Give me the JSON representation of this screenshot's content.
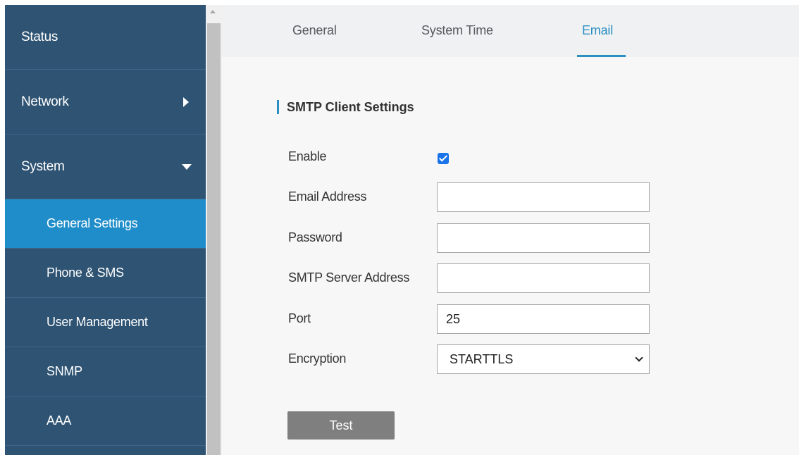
{
  "sidebar": {
    "items": [
      {
        "label": "Status"
      },
      {
        "label": "Network"
      },
      {
        "label": "System"
      }
    ],
    "sub_items": [
      {
        "label": "General Settings",
        "active": true
      },
      {
        "label": "Phone & SMS"
      },
      {
        "label": "User Management"
      },
      {
        "label": "SNMP"
      },
      {
        "label": "AAA"
      }
    ]
  },
  "tabs": [
    {
      "label": "General"
    },
    {
      "label": "System Time"
    },
    {
      "label": "Email",
      "active": true
    }
  ],
  "section": {
    "title": "SMTP Client Settings"
  },
  "form": {
    "enable": {
      "label": "Enable",
      "checked": true
    },
    "email_address": {
      "label": "Email Address",
      "value": ""
    },
    "password": {
      "label": "Password",
      "value": ""
    },
    "smtp_server": {
      "label": "SMTP Server Address",
      "value": ""
    },
    "port": {
      "label": "Port",
      "value": "25"
    },
    "encryption": {
      "label": "Encryption",
      "value": "STARTTLS"
    }
  },
  "buttons": {
    "test_label": "Test"
  },
  "colors": {
    "sidebar_bg": "#2e5373",
    "active_item": "#1f8dc9",
    "accent": "#2b8fc4",
    "button_bg": "#7f7f7f"
  }
}
